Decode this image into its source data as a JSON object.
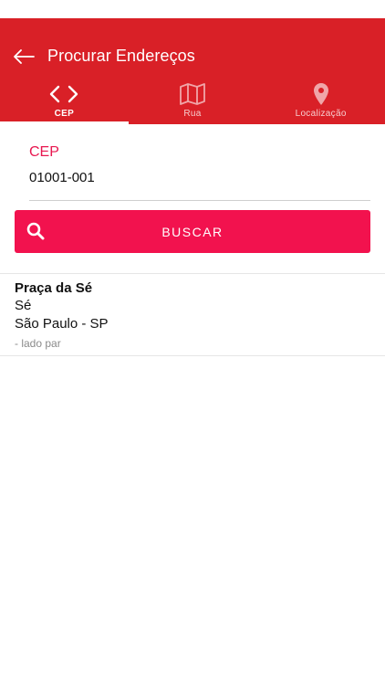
{
  "header": {
    "title": "Procurar Endereços"
  },
  "tabs": [
    {
      "label": "CEP",
      "icon": "code-icon",
      "active": true
    },
    {
      "label": "Rua",
      "icon": "map-icon",
      "active": false
    },
    {
      "label": "Localização",
      "icon": "location-pin-icon",
      "active": false
    }
  ],
  "cep_field": {
    "label": "CEP",
    "value": "01001-001"
  },
  "search_button": {
    "label": "BUSCAR",
    "icon": "search-icon"
  },
  "results": [
    {
      "street": "Praça da Sé",
      "neighborhood": "Sé",
      "city_state": "São Paulo - SP",
      "note": "- lado par"
    }
  ],
  "colors": {
    "header": "#d92027",
    "accent": "#f2124e",
    "label_accent": "#e8174f"
  }
}
